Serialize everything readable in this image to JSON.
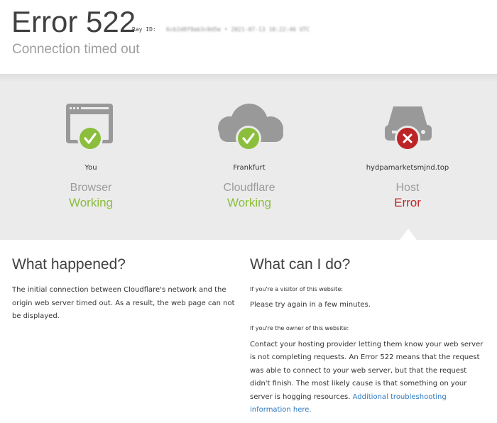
{
  "header": {
    "title": "Error 522",
    "ray_label": "Ray ID:",
    "ray_value": "6cb2d8f9ab3c0d5e • 2021-07-13 10:22:46 UTC",
    "subtitle": "Connection timed out"
  },
  "diagram": {
    "nodes": [
      {
        "location": "You",
        "kind": "Browser",
        "status": "Working",
        "icon": "browser-window-icon",
        "badge": "check-icon"
      },
      {
        "location": "Frankfurt",
        "kind": "Cloudflare",
        "status": "Working",
        "icon": "cloud-icon",
        "badge": "check-icon"
      },
      {
        "location": "hydpamarketsmjnd.top",
        "kind": "Host",
        "status": "Error",
        "icon": "server-icon",
        "badge": "x-icon"
      }
    ]
  },
  "what_happened": {
    "heading": "What happened?",
    "body": "The initial connection between Cloudflare's network and the origin web server timed out. As a result, the web page can not be displayed."
  },
  "what_can_i_do": {
    "heading": "What can I do?",
    "visitor_label": "If you're a visitor of this website:",
    "visitor_text": "Please try again in a few minutes.",
    "owner_label": "If you're the owner of this website:",
    "owner_text": "Contact your hosting provider letting them know your web server is not completing requests. An Error 522 means that the request was able to connect to your web server, but that the request didn't finish. The most likely cause is that something on your server is hogging resources.",
    "link_text": "Additional troubleshooting information here."
  },
  "colors": {
    "working": "#8bbe3c",
    "error": "#bd2426",
    "icon_gray": "#999999",
    "link": "#2f7bbf",
    "panel": "#ebebeb"
  }
}
